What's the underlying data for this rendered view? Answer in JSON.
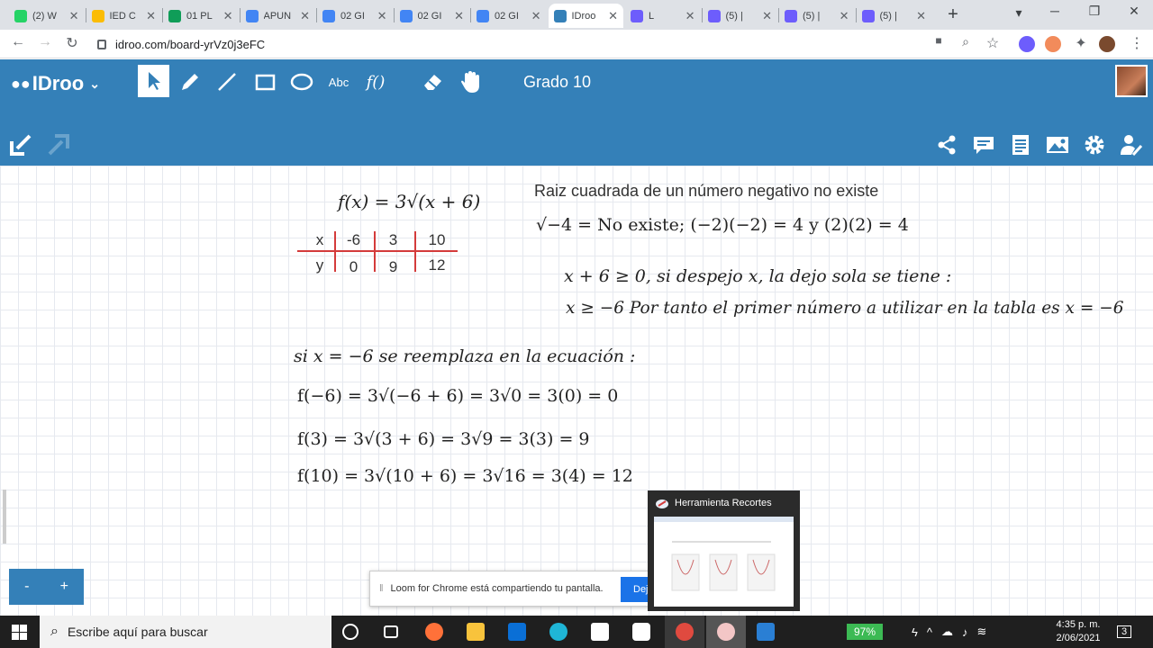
{
  "browser": {
    "tabs": [
      {
        "label": "(2) W",
        "color": "#25d366"
      },
      {
        "label": "IED C",
        "color": "#fbbc04"
      },
      {
        "label": "01 PL",
        "color": "#0f9d58"
      },
      {
        "label": "APUN",
        "color": "#4285f4"
      },
      {
        "label": "02 GI",
        "color": "#4285f4"
      },
      {
        "label": "02 GI",
        "color": "#4285f4"
      },
      {
        "label": "02 GI",
        "color": "#4285f4"
      },
      {
        "label": "IDroo",
        "color": "#3480b8",
        "active": true
      },
      {
        "label": "L",
        "color": "#6d5dfc"
      },
      {
        "label": "(5) |",
        "color": "#6d5dfc"
      },
      {
        "label": "(5) |",
        "color": "#6d5dfc"
      },
      {
        "label": "(5) |",
        "color": "#6d5dfc"
      }
    ],
    "url": "idroo.com/board-yrVz0j3eFC"
  },
  "app": {
    "logo": "IDroo",
    "board_name": "Grado 10",
    "text_tool_label": "Abc",
    "function_tool_label": "f()"
  },
  "board": {
    "function": "f(x) = 3√(x + 6)",
    "table": {
      "x_label": "x",
      "y_label": "y",
      "x_values": [
        "-6",
        "3",
        "10"
      ],
      "y_values": [
        "0",
        "9",
        "12"
      ]
    },
    "note_title": "Raiz cuadrada de un número negativo no existe",
    "note_line": "√−4 = No existe; (−2)(−2) = 4 y (2)(2) = 4",
    "inequality": "x + 6  ≥ 0, si despejo x, la dejo sola se tiene :",
    "conclusion": "x ≥ −6  Por tanto el primer número a utilizar en la tabla es x = −6",
    "substitution_intro": "si x = −6 se reemplaza en la ecuación :",
    "eval_1": "f(−6) = 3√(−6 + 6) = 3√0 = 3(0) = 0",
    "eval_2": "f(3) = 3√(3 + 6) = 3√9 = 3(3) = 9",
    "eval_3": "f(10) = 3√(10 + 6) = 3√16 = 3(4) = 12"
  },
  "zoom": {
    "minus": "-",
    "plus": "+"
  },
  "snip_popup": {
    "title": "Herramienta Recortes"
  },
  "loom": {
    "message": "Loom for Chrome está compartiendo tu pantalla.",
    "button": "Dej"
  },
  "taskbar": {
    "search_placeholder": "Escribe aquí para buscar",
    "battery": "97%",
    "time": "4:35 p. m.",
    "date": "2/06/2021",
    "notifications": "3"
  }
}
